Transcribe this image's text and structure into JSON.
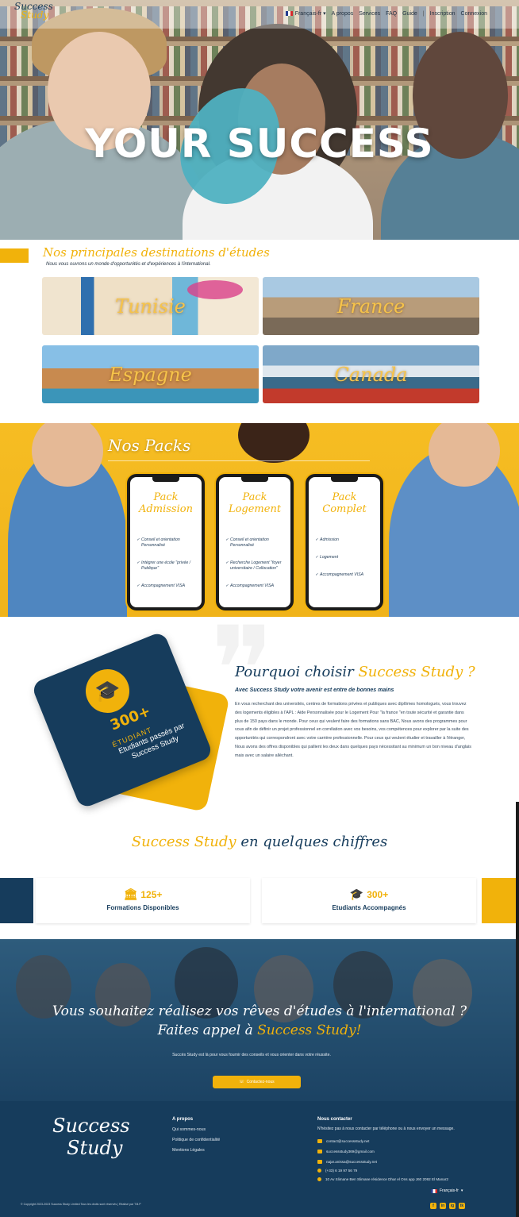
{
  "nav": {
    "logo_line1": "Success",
    "logo_line2": "Study",
    "language": "Français-fr",
    "links": [
      "A propos",
      "Services",
      "FAQ",
      "Guide"
    ],
    "separator": "|",
    "inscription": "Inscription",
    "connexion": "Connexion"
  },
  "hero": {
    "title": "YOUR SUCCESS"
  },
  "destinations": {
    "title": "Nos principales destinations d'études",
    "subtitle": "Nous vous ouvrons un monde d'opportunités et d'expériences à l'international.",
    "items": [
      {
        "label": "Tunisie"
      },
      {
        "label": "France"
      },
      {
        "label": "Espagne"
      },
      {
        "label": "Canada"
      }
    ]
  },
  "packs": {
    "title": "Nos Packs",
    "items": [
      {
        "title": "Pack Admission",
        "features": [
          "Conseil et orientation Personnalisé",
          "Intégrer une école \"privée / Publique\"",
          "Accompagnement VISA"
        ]
      },
      {
        "title": "Pack Logement",
        "features": [
          "Conseil et orientation Personnalisé",
          "Recherche Logement \"foyer universitaire / Collocation\"",
          "Accompagnement VISA"
        ]
      },
      {
        "title": "Pack Complet",
        "features": [
          "Admission",
          "Logement",
          "Accompagnement VISA"
        ]
      }
    ]
  },
  "why": {
    "card_count": "300+",
    "card_unit": "ÉTUDIANT",
    "card_caption": "Etudiants passés par Success Study",
    "title_prefix": "Pourquoi choisir",
    "title_accent": "Success Study ?",
    "subtitle": "Avec Success Study votre avenir est entre de bonnes mains",
    "body": "En vous recherchant des universités, centres de formations privées et publiques avec diplômes homologués, vous trouvez des logements éligibles à l'APL : Aide Personnalisée pour le Logement Pour \"la france \"en toute sécurité et garantie dans plus de 150 pays dans le monde. Pour ceux qui veulent faire des formations sans BAC, Nous avons des programmes pour vous afin de définir un projet professionnel en corrélation avec vos besoins, vos compétences pour explorer par la suite des opportunités qui correspondront avec votre carrière professionnelle. Pour ceux qui veulent étudier et travailler à l'étranger, Nous avons des offres disponibles qui pallient les deux dans quelques pays nécessitant au minimum un bon niveau d'anglais mais avec un salaire alléchant."
  },
  "figures": {
    "title_accent": "Success Study",
    "title_rest": "en quelques chiffres",
    "stats": [
      {
        "icon": "building-icon",
        "value": "125+",
        "label": "Formations Disponibles"
      },
      {
        "icon": "graduates-icon",
        "value": "300+",
        "label": "Etudiants Accompagnés"
      }
    ]
  },
  "cta": {
    "title_main": "Vous souhaitez réalisez vos rêves d'études à l'international ? Faites appel à",
    "title_accent": "Success Study!",
    "text": "Succès Study est là pour vous fournir des conseils et vous orienter dans votre réussite.",
    "button": "Contactez-nous"
  },
  "footer": {
    "logo_line1": "Success",
    "logo_line2": "Study",
    "about_title": "A propos",
    "about_links": [
      "Qui sommes-nous",
      "Politique de confidentialité",
      "Mentions Légales"
    ],
    "contact_title": "Nous contacter",
    "contact_intro": "N'hésitez pas à nous contacter par téléphone ou à nous envoyer un message.",
    "contacts": [
      {
        "icon": "mail-icon",
        "text": "contact@successstudy.net"
      },
      {
        "icon": "mail-icon",
        "text": "successstudy369@gmail.com"
      },
      {
        "icon": "mail-icon",
        "text": "najar.anissa@successstudy.net"
      },
      {
        "icon": "whatsapp-icon",
        "text": "(+33) 6 19 97 56 79"
      },
      {
        "icon": "location-icon",
        "text": "10 Av Slimane Ben Slimane résidence Dhar el Ons app J60 2092 El Manar2"
      }
    ],
    "copyright": "© Copyright 2023-2023 Success Study Limited Tous les droits sont réservés | Réalisé par T.B.P",
    "language": "Français-fr",
    "social": [
      "f",
      "in",
      "ig",
      "tk"
    ]
  },
  "colors": {
    "brand_yellow": "#f1b20b",
    "brand_navy": "#163c5c",
    "hero_blob": "#37a7b8"
  }
}
